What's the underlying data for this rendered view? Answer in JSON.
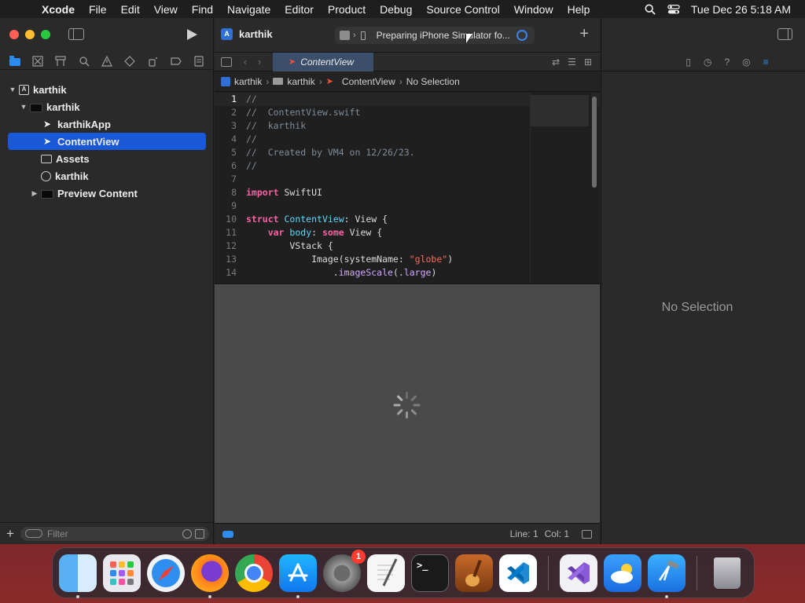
{
  "menubar": {
    "app_name": "Xcode",
    "items": [
      "File",
      "Edit",
      "View",
      "Find",
      "Navigate",
      "Editor",
      "Product",
      "Debug",
      "Source Control",
      "Window",
      "Help"
    ],
    "clock": "Tue Dec 26  5:18 AM"
  },
  "toolbar": {
    "project_name": "karthik",
    "activity_status": "Preparing iPhone Simulator fo...",
    "add_label": "+"
  },
  "navigator": {
    "tree": [
      {
        "label": "karthik",
        "kind": "project",
        "indent": 0,
        "expanded": true
      },
      {
        "label": "karthik",
        "kind": "folder",
        "indent": 1,
        "expanded": true
      },
      {
        "label": "karthikApp",
        "kind": "swift",
        "indent": 2
      },
      {
        "label": "ContentView",
        "kind": "swift",
        "indent": 2,
        "selected": true
      },
      {
        "label": "Assets",
        "kind": "assets",
        "indent": 2
      },
      {
        "label": "karthik",
        "kind": "entitlements",
        "indent": 2
      },
      {
        "label": "Preview Content",
        "kind": "folder",
        "indent": 2,
        "expanded": false
      }
    ],
    "filter_placeholder": "Filter"
  },
  "editor": {
    "tab_label": "ContentView",
    "jumpbar": [
      "karthik",
      "karthik",
      "ContentView",
      "No Selection"
    ],
    "code_lines": [
      [
        {
          "t": "//",
          "c": "comment"
        }
      ],
      [
        {
          "t": "//  ContentView.swift",
          "c": "comment"
        }
      ],
      [
        {
          "t": "//  karthik",
          "c": "comment"
        }
      ],
      [
        {
          "t": "//",
          "c": "comment"
        }
      ],
      [
        {
          "t": "//  Created by VM4 on 12/26/23.",
          "c": "comment"
        }
      ],
      [
        {
          "t": "//",
          "c": "comment"
        }
      ],
      [
        {
          "t": "",
          "c": ""
        }
      ],
      [
        {
          "t": "import",
          "c": "kw"
        },
        {
          "t": " SwiftUI",
          "c": ""
        }
      ],
      [
        {
          "t": "",
          "c": ""
        }
      ],
      [
        {
          "t": "struct",
          "c": "kw"
        },
        {
          "t": " ",
          "c": ""
        },
        {
          "t": "ContentView",
          "c": "type"
        },
        {
          "t": ": View {",
          "c": ""
        }
      ],
      [
        {
          "t": "    ",
          "c": ""
        },
        {
          "t": "var",
          "c": "kw"
        },
        {
          "t": " ",
          "c": ""
        },
        {
          "t": "body",
          "c": "type"
        },
        {
          "t": ": ",
          "c": ""
        },
        {
          "t": "some",
          "c": "kw"
        },
        {
          "t": " View {",
          "c": ""
        }
      ],
      [
        {
          "t": "        VStack {",
          "c": ""
        }
      ],
      [
        {
          "t": "            Image(systemName: ",
          "c": ""
        },
        {
          "t": "\"globe\"",
          "c": "str"
        },
        {
          "t": ")",
          "c": ""
        }
      ],
      [
        {
          "t": "                .",
          "c": ""
        },
        {
          "t": "imageScale",
          "c": "call"
        },
        {
          "t": "(.",
          "c": ""
        },
        {
          "t": "large",
          "c": "call"
        },
        {
          "t": ")",
          "c": ""
        }
      ]
    ],
    "status_line": "Line: 1",
    "status_col": "Col: 1"
  },
  "inspector": {
    "empty_label": "No Selection"
  },
  "dock": {
    "settings_badge": "1",
    "terminal_prompt": ">_"
  }
}
